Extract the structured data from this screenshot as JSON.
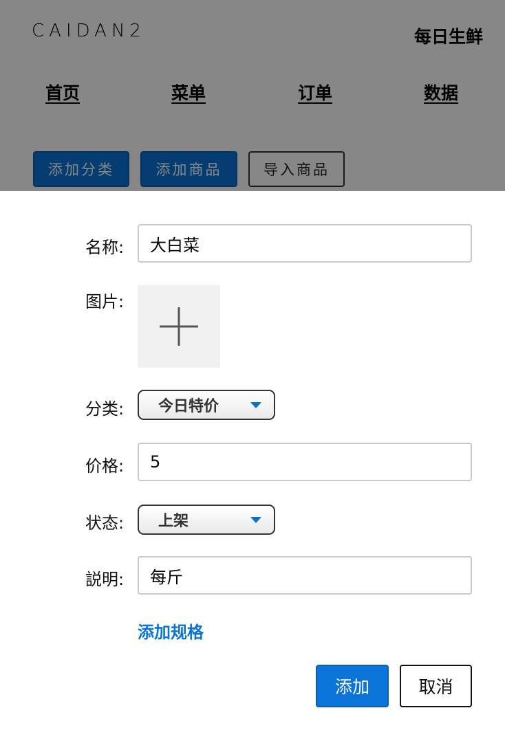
{
  "header": {
    "logo_text": "CAIDAN2",
    "store_name": "每日生鲜"
  },
  "nav": {
    "items": [
      "首页",
      "菜单",
      "订单",
      "数据"
    ]
  },
  "toolbar": {
    "add_category_label": "添加分类",
    "add_product_label": "添加商品",
    "import_products_label": "导入商品"
  },
  "form": {
    "name_label": "名称:",
    "name_value": "大白菜",
    "image_label": "图片:",
    "image_upload_icon": "plus-icon",
    "category_label": "分类:",
    "category_value": "今日特价",
    "price_label": "价格:",
    "price_value": "5",
    "status_label": "状态:",
    "status_value": "上架",
    "description_label": "説明:",
    "description_value": "每斤",
    "add_spec_link": "添加规格",
    "submit_label": "添加",
    "cancel_label": "取消"
  },
  "colors": {
    "primary": "#0a74d8",
    "caret": "#0b73c7",
    "overlay": "rgba(0,0,0,0.47)"
  }
}
